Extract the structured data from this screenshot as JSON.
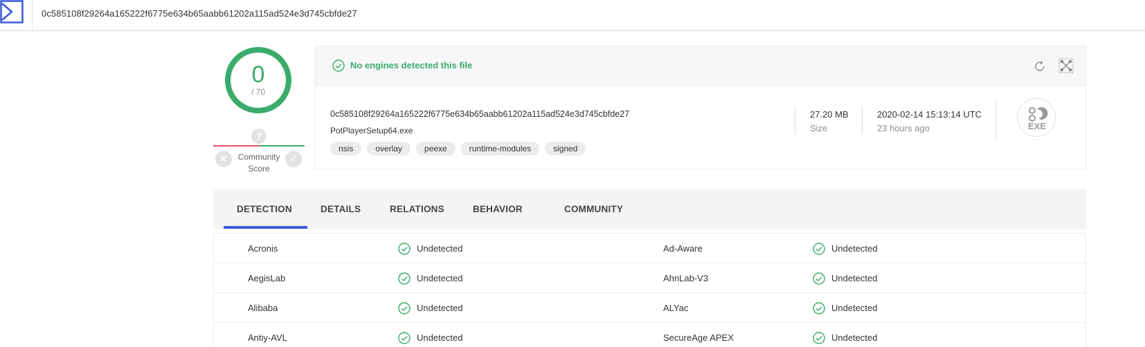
{
  "topbar": {
    "search_value": "0c585108f29264a165222f6775e634b65aabb61202a115ad524e3d745cbfde27"
  },
  "score": {
    "detections": "0",
    "total": "/ 70"
  },
  "community": {
    "question_mark": "?",
    "label_line1": "Community",
    "label_line2": "Score",
    "downvote_symbol": "✕",
    "upvote_symbol": "✓"
  },
  "summary": {
    "banner_text": "No engines detected this file",
    "hash": "0c585108f29264a165222f6775e634b65aabb61202a115ad524e3d745cbfde27",
    "filename": "PotPlayerSetup64.exe",
    "tags": [
      "nsis",
      "overlay",
      "peexe",
      "runtime-modules",
      "signed"
    ],
    "size_value": "27.20 MB",
    "size_label": "Size",
    "date_value": "2020-02-14 15:13:14 UTC",
    "date_label": "23 hours ago",
    "file_type": "EXE"
  },
  "tabs": [
    "DETECTION",
    "DETAILS",
    "RELATIONS",
    "BEHAVIOR",
    "COMMUNITY"
  ],
  "active_tab": "DETECTION",
  "detections": [
    {
      "left_engine": "Acronis",
      "left_result": "Undetected",
      "right_engine": "Ad-Aware",
      "right_result": "Undetected"
    },
    {
      "left_engine": "AegisLab",
      "left_result": "Undetected",
      "right_engine": "AhnLab-V3",
      "right_result": "Undetected"
    },
    {
      "left_engine": "Alibaba",
      "left_result": "Undetected",
      "right_engine": "ALYac",
      "right_result": "Undetected"
    },
    {
      "left_engine": "Antiy-AVL",
      "left_result": "Undetected",
      "right_engine": "SecureAge APEX",
      "right_result": "Undetected"
    }
  ],
  "colors": {
    "clean": "#3bab6c",
    "malicious": "#e25563",
    "accent": "#3b5bdb"
  }
}
